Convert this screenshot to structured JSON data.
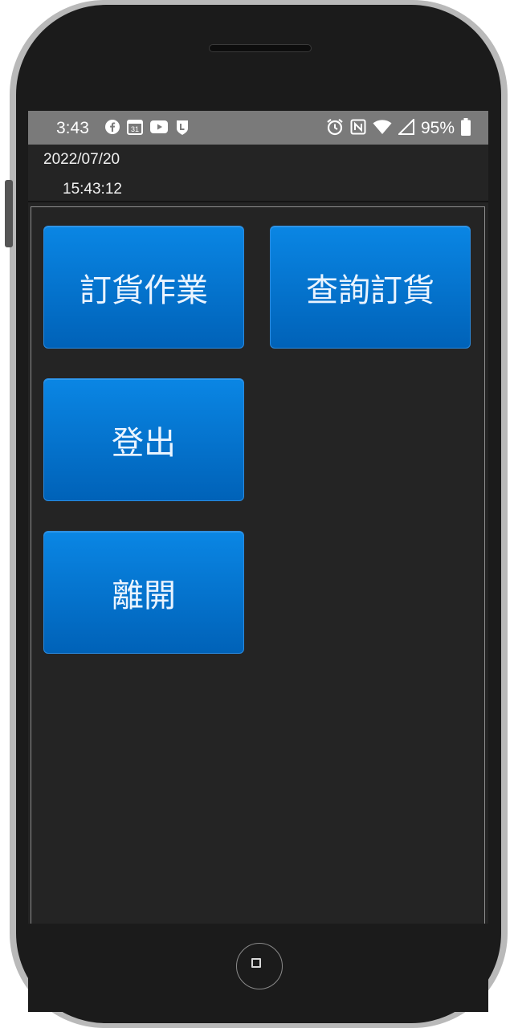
{
  "status_bar": {
    "time": "3:43",
    "calendar_day": "31",
    "battery_percent": "95%",
    "left_icons": [
      "facebook-icon",
      "calendar-icon",
      "youtube-icon",
      "line-icon"
    ],
    "right_icons": [
      "alarm-icon",
      "nfc-icon",
      "wifi-icon",
      "cell-signal-icon",
      "battery-icon"
    ]
  },
  "header": {
    "date": "2022/07/20",
    "time": "15:43:12"
  },
  "menu": {
    "order_label": "訂貨作業",
    "query_label": "查詢訂貨",
    "logout_label": "登出",
    "exit_label": "離開"
  },
  "colors": {
    "button_top": "#0a86e4",
    "button_bottom": "#0062b8",
    "background": "#242424",
    "status_bar": "#7a7a7a"
  }
}
